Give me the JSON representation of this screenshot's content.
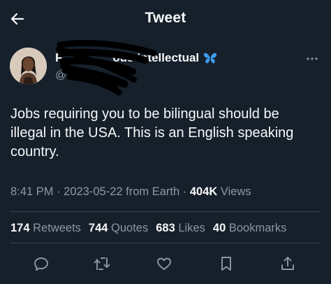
{
  "header": {
    "title": "Tweet"
  },
  "author": {
    "display_name_visible_start": "F",
    "display_name_visible_end": "ous Intellectual",
    "handle_visible": "@           x"
  },
  "tweet": {
    "text": "Jobs requiring you to be bilingual should be illegal in the USA. This is an English speaking country.",
    "time": "8:41 PM",
    "date": "2023-05-22",
    "source": "from Earth",
    "views_count": "404K",
    "views_label": "Views"
  },
  "stats": {
    "retweets_count": "174",
    "retweets_label": "Retweets",
    "quotes_count": "744",
    "quotes_label": "Quotes",
    "likes_count": "683",
    "likes_label": "Likes",
    "bookmarks_count": "40",
    "bookmarks_label": "Bookmarks"
  },
  "icons": {
    "back": "arrow-left-icon",
    "verified": "butterfly-emoji-icon",
    "more": "more-horizontal-icon",
    "reply": "reply-icon",
    "retweet": "retweet-icon",
    "like": "heart-icon",
    "bookmark": "bookmark-icon",
    "share": "share-icon"
  },
  "colors": {
    "background": "#15202b",
    "text_primary": "#f7f9f9",
    "text_secondary": "#8b98a5",
    "divider": "#38444d",
    "butterfly": "#3d9cf0"
  }
}
